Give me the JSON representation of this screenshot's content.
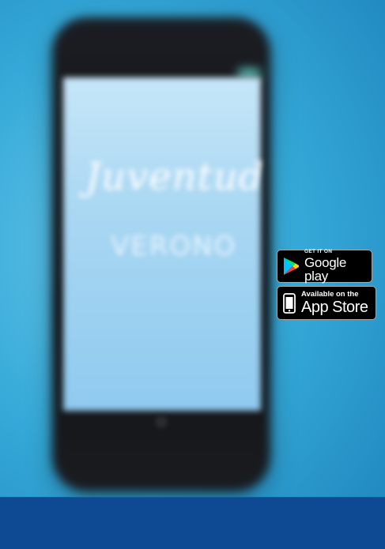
{
  "phone_screen": {
    "title": "Juventud",
    "subtitle": "VERONO"
  },
  "badges": {
    "google": {
      "small": "GET IT ON",
      "big": "Google play"
    },
    "apple": {
      "small": "Available on the",
      "big": "App Store"
    }
  },
  "colors": {
    "background": "#35a9d8",
    "bottom_bar": "#0e4a94",
    "badge": "#000000"
  },
  "icons": [
    "google-play-icon",
    "apple-icon"
  ]
}
